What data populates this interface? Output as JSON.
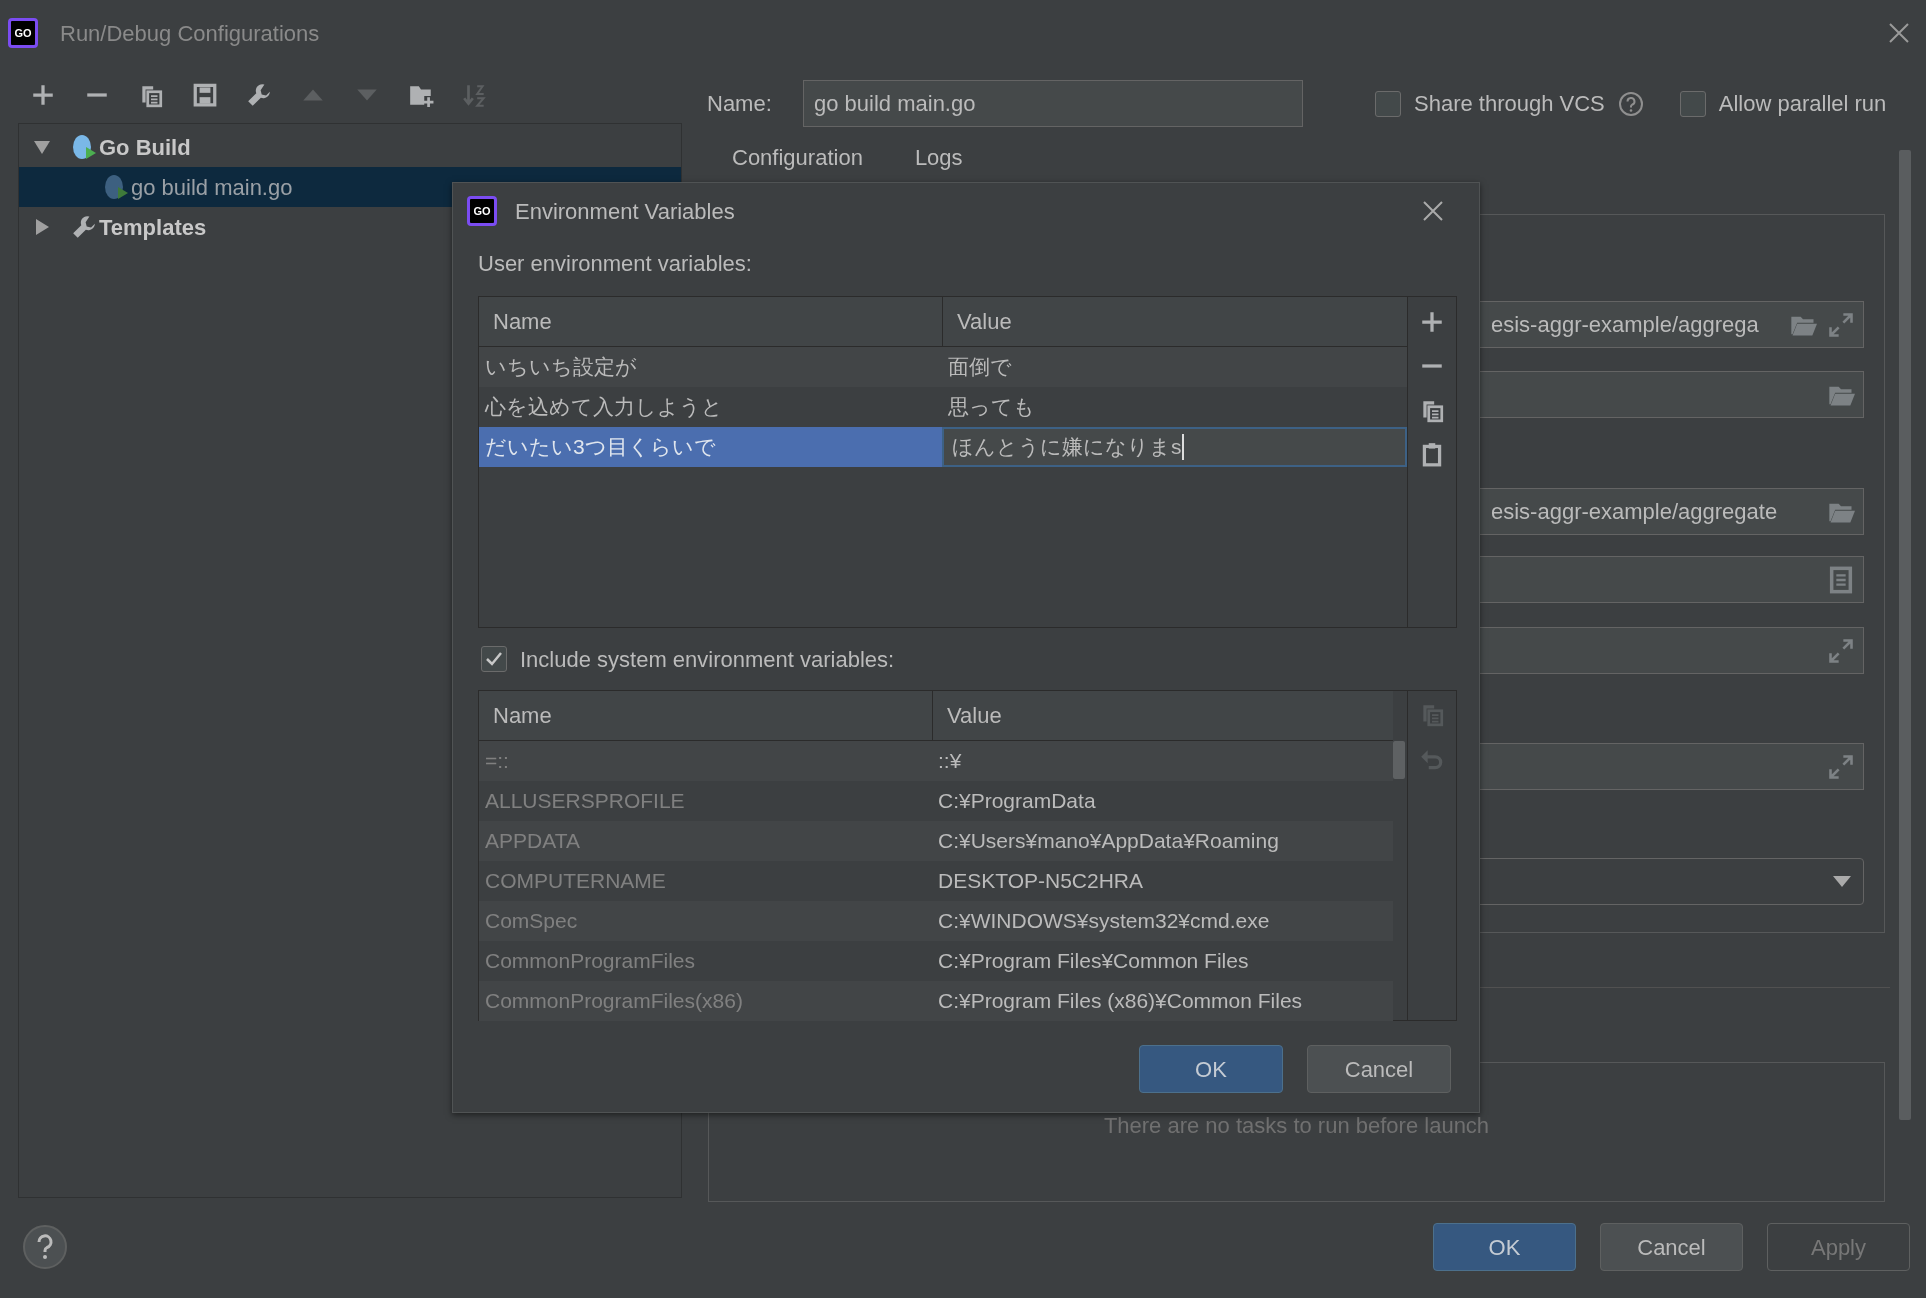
{
  "window": {
    "logo": "GO",
    "title": "Run/Debug Configurations"
  },
  "toolbar": [
    {
      "kind": "add",
      "disabled": false
    },
    {
      "kind": "remove",
      "disabled": false
    },
    {
      "kind": "copy",
      "disabled": false
    },
    {
      "kind": "save",
      "disabled": false
    },
    {
      "kind": "wrench",
      "disabled": false
    },
    {
      "kind": "up",
      "disabled": true
    },
    {
      "kind": "down",
      "disabled": true
    },
    {
      "kind": "folder-add",
      "disabled": false
    },
    {
      "kind": "sort",
      "disabled": true
    }
  ],
  "tree": [
    {
      "label": "Go Build",
      "kind": "run-config",
      "expanded": true,
      "selected": false,
      "children": [
        {
          "label": "go build main.go",
          "kind": "run-config",
          "selected": true
        }
      ]
    },
    {
      "label": "Templates",
      "kind": "wrench",
      "expanded": false,
      "selected": false
    }
  ],
  "name_field": {
    "label": "Name:",
    "value": "go build main.go"
  },
  "options": [
    {
      "label": "Share through VCS",
      "checked": false,
      "help": true
    },
    {
      "label": "Allow parallel run",
      "checked": false,
      "help": false
    }
  ],
  "tabs": [
    {
      "label": "Configuration"
    },
    {
      "label": "Logs"
    }
  ],
  "fields": [
    {
      "kind": "text",
      "value": "esis-aggr-example/aggrega",
      "icons": [
        {
          "kind": "folder"
        },
        {
          "kind": "expand"
        }
      ]
    },
    {
      "kind": "text",
      "icons": [
        {
          "kind": "folder"
        }
      ]
    },
    {
      "kind": "text",
      "value": "esis-aggr-example/aggregate",
      "icons": [
        {
          "kind": "folder"
        }
      ]
    },
    {
      "kind": "text",
      "icons": [
        {
          "kind": "document"
        }
      ]
    },
    {
      "kind": "text",
      "icons": [
        {
          "kind": "expand"
        }
      ]
    },
    {
      "kind": "text",
      "icons": [
        {
          "kind": "expand"
        }
      ]
    },
    {
      "kind": "dropdown"
    }
  ],
  "before_launch": {
    "empty_text": "There are no tasks to run before launch"
  },
  "buttons": [
    {
      "label": "OK",
      "kind": "primary"
    },
    {
      "label": "Cancel",
      "kind": "normal"
    },
    {
      "label": "Apply",
      "kind": "disabled"
    }
  ],
  "dialog": {
    "logo": "GO",
    "title": "Environment Variables",
    "user_label": "User environment variables:",
    "user_table": {
      "columns": [
        "Name",
        "Value"
      ],
      "rows": [
        {
          "name": "いちいち設定が",
          "value": "面倒で",
          "selected": false,
          "editing": false
        },
        {
          "name": "心を込めて入力しようと",
          "value": "思っても",
          "selected": false,
          "editing": false
        },
        {
          "name": "だいたい3つ目くらいで",
          "value": "ほんとうに嫌になりまs",
          "selected": true,
          "editing": true
        }
      ]
    },
    "user_actions": [
      {
        "kind": "add",
        "disabled": false
      },
      {
        "kind": "remove",
        "disabled": false
      },
      {
        "kind": "copy",
        "disabled": false
      },
      {
        "kind": "paste",
        "disabled": false
      }
    ],
    "include_system": {
      "label": "Include system environment variables:",
      "checked": true
    },
    "system_table": {
      "columns": [
        "Name",
        "Value"
      ],
      "rows": [
        {
          "name": "=::",
          "value": "::¥"
        },
        {
          "name": "ALLUSERSPROFILE",
          "value": "C:¥ProgramData"
        },
        {
          "name": "APPDATA",
          "value": "C:¥Users¥mano¥AppData¥Roaming"
        },
        {
          "name": "COMPUTERNAME",
          "value": "DESKTOP-N5C2HRA"
        },
        {
          "name": "ComSpec",
          "value": "C:¥WINDOWS¥system32¥cmd.exe"
        },
        {
          "name": "CommonProgramFiles",
          "value": "C:¥Program Files¥Common Files"
        },
        {
          "name": "CommonProgramFiles(x86)",
          "value": "C:¥Program Files (x86)¥Common Files"
        }
      ]
    },
    "system_actions": [
      {
        "kind": "copy",
        "disabled": true
      },
      {
        "kind": "revert",
        "disabled": true
      }
    ],
    "buttons": [
      {
        "label": "OK",
        "kind": "primary"
      },
      {
        "label": "Cancel",
        "kind": "normal"
      }
    ]
  }
}
